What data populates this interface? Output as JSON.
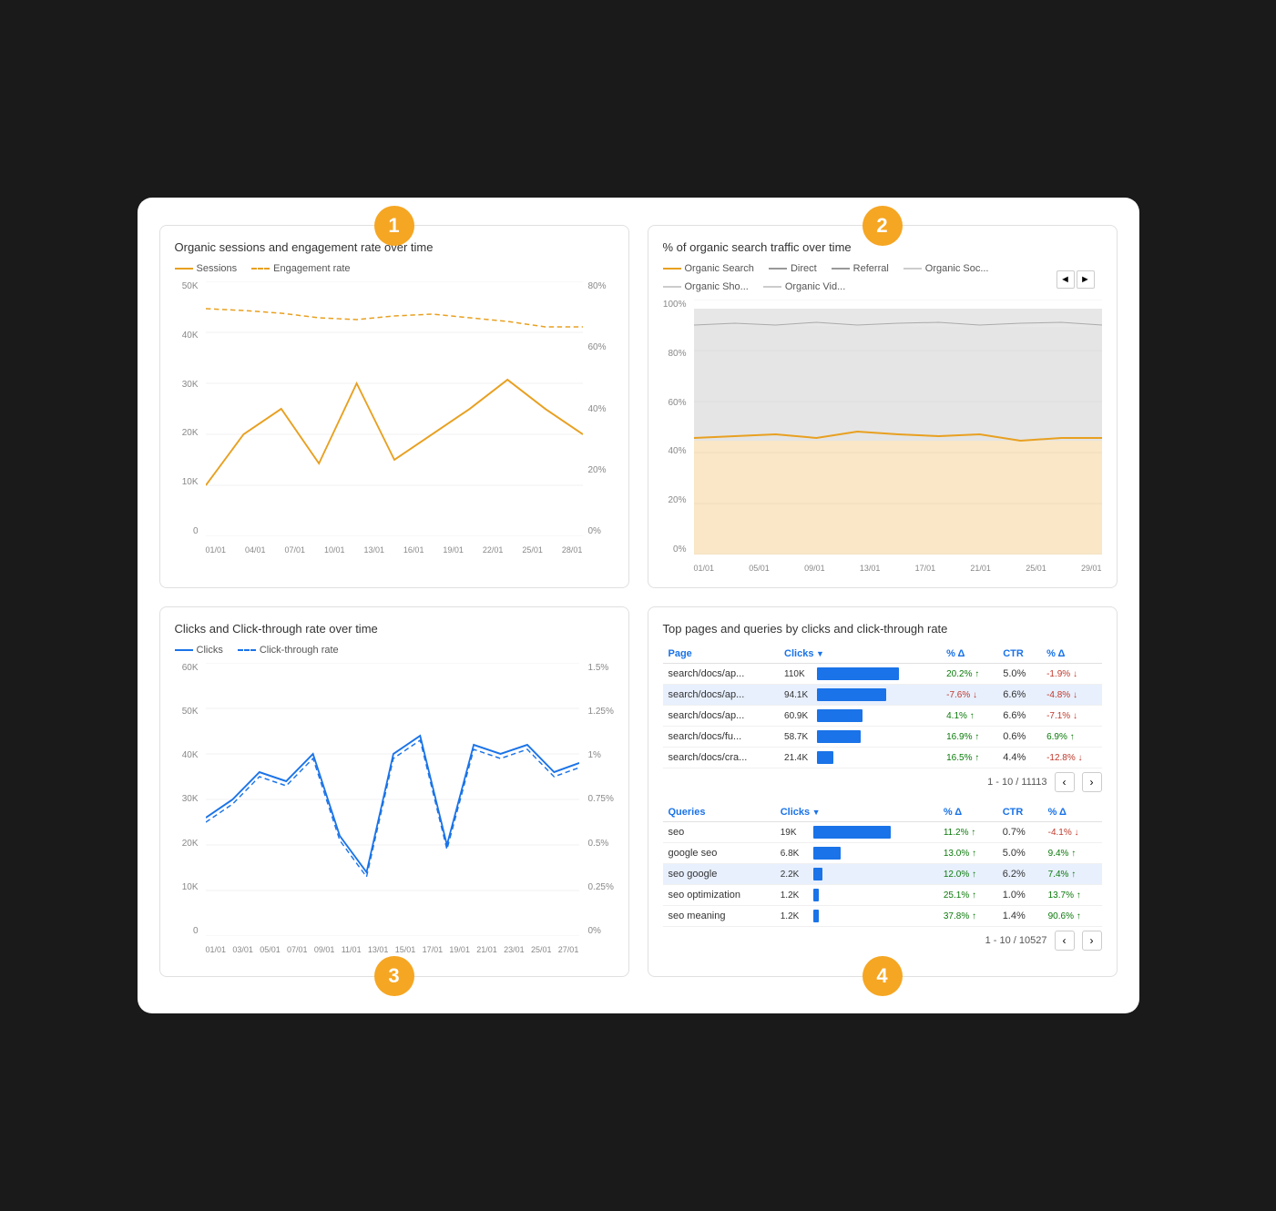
{
  "panel1": {
    "title": "Organic sessions and engagement rate over time",
    "badge": "1",
    "legend": [
      {
        "label": "Sessions",
        "color": "#E8A020",
        "style": "solid"
      },
      {
        "label": "Engagement rate",
        "color": "#E8A020",
        "style": "dashed"
      }
    ],
    "yAxisLeft": [
      "50K",
      "40K",
      "30K",
      "20K",
      "10K",
      "0"
    ],
    "yAxisRight": [
      "80%",
      "60%",
      "40%",
      "20%",
      "0%"
    ],
    "xAxis": [
      "01/01",
      "04/01",
      "07/01",
      "10/01",
      "13/01",
      "16/01",
      "19/01",
      "22/01",
      "25/01",
      "28/01"
    ]
  },
  "panel2": {
    "title": "% of organic search traffic over time",
    "badge": "2",
    "legend": [
      {
        "label": "Organic Search",
        "color": "#E8A020",
        "style": "solid"
      },
      {
        "label": "Direct",
        "color": "#999",
        "style": "solid"
      },
      {
        "label": "Referral",
        "color": "#999",
        "style": "solid"
      },
      {
        "label": "Organic Soc...",
        "color": "#ccc",
        "style": "solid"
      },
      {
        "label": "Organic Sho...",
        "color": "#ccc",
        "style": "solid"
      },
      {
        "label": "Organic Vid...",
        "color": "#ccc",
        "style": "solid"
      }
    ],
    "yAxisLeft": [
      "100%",
      "80%",
      "60%",
      "40%",
      "20%",
      "0%"
    ],
    "xAxis": [
      "01/01",
      "05/01",
      "09/01",
      "13/01",
      "17/01",
      "21/01",
      "25/01",
      "29/01"
    ]
  },
  "panel3": {
    "title": "Clicks and Click-through rate over time",
    "badge": "3",
    "legend": [
      {
        "label": "Clicks",
        "color": "#1a73e8",
        "style": "solid"
      },
      {
        "label": "Click-through rate",
        "color": "#1a73e8",
        "style": "dashed"
      }
    ],
    "yAxisLeft": [
      "60K",
      "50K",
      "40K",
      "30K",
      "20K",
      "10K",
      "0"
    ],
    "yAxisRight": [
      "1.5%",
      "1.25%",
      "1%",
      "0.75%",
      "0.5%",
      "0.25%",
      "0%"
    ],
    "xAxis": [
      "01/01",
      "03/01",
      "05/01",
      "07/01",
      "09/01",
      "11/01",
      "13/01",
      "15/01",
      "17/01",
      "19/01",
      "21/01",
      "23/01",
      "25/01",
      "27/01"
    ]
  },
  "panel4": {
    "title": "Top pages and queries by clicks and click-through rate",
    "badge": "4",
    "pagesTable": {
      "headers": [
        "Page",
        "Clicks",
        "% Δ",
        "CTR",
        "% Δ"
      ],
      "rows": [
        {
          "page": "search/docs/ap...",
          "clicks": "110K",
          "barWidth": 90,
          "deltaPct": "20.2%",
          "deltaDir": "up",
          "ctr": "5.0%",
          "ctrDelta": "-1.9%",
          "ctrDir": "down",
          "highlighted": false
        },
        {
          "page": "search/docs/ap...",
          "clicks": "94.1K",
          "barWidth": 76,
          "deltaPct": "-7.6%",
          "deltaDir": "down",
          "ctr": "6.6%",
          "ctrDelta": "-4.8%",
          "ctrDir": "down",
          "highlighted": true
        },
        {
          "page": "search/docs/ap...",
          "clicks": "60.9K",
          "barWidth": 50,
          "deltaPct": "4.1%",
          "deltaDir": "up",
          "ctr": "6.6%",
          "ctrDelta": "-7.1%",
          "ctrDir": "down",
          "highlighted": false
        },
        {
          "page": "search/docs/fu...",
          "clicks": "58.7K",
          "barWidth": 48,
          "deltaPct": "16.9%",
          "deltaDir": "up",
          "ctr": "0.6%",
          "ctrDelta": "6.9%",
          "ctrDir": "up",
          "highlighted": false
        },
        {
          "page": "search/docs/cra...",
          "clicks": "21.4K",
          "barWidth": 18,
          "deltaPct": "16.5%",
          "deltaDir": "up",
          "ctr": "4.4%",
          "ctrDelta": "-12.8%",
          "ctrDir": "down",
          "highlighted": false
        }
      ],
      "pagination": "1 - 10 / 11113"
    },
    "queriesTable": {
      "headers": [
        "Queries",
        "Clicks",
        "% Δ",
        "CTR",
        "% Δ"
      ],
      "rows": [
        {
          "query": "seo",
          "clicks": "19K",
          "barWidth": 85,
          "deltaPct": "11.2%",
          "deltaDir": "up",
          "ctr": "0.7%",
          "ctrDelta": "-4.1%",
          "ctrDir": "down",
          "highlighted": false
        },
        {
          "query": "google seo",
          "clicks": "6.8K",
          "barWidth": 30,
          "deltaPct": "13.0%",
          "deltaDir": "up",
          "ctr": "5.0%",
          "ctrDelta": "9.4%",
          "ctrDir": "up",
          "highlighted": false
        },
        {
          "query": "seo google",
          "clicks": "2.2K",
          "barWidth": 10,
          "deltaPct": "12.0%",
          "deltaDir": "up",
          "ctr": "6.2%",
          "ctrDelta": "7.4%",
          "ctrDir": "up",
          "highlighted": true
        },
        {
          "query": "seo optimization",
          "clicks": "1.2K",
          "barWidth": 6,
          "deltaPct": "25.1%",
          "deltaDir": "up",
          "ctr": "1.0%",
          "ctrDelta": "13.7%",
          "ctrDir": "up",
          "highlighted": false
        },
        {
          "query": "seo meaning",
          "clicks": "1.2K",
          "barWidth": 6,
          "deltaPct": "37.8%",
          "deltaDir": "up",
          "ctr": "1.4%",
          "ctrDelta": "90.6%",
          "ctrDir": "up",
          "highlighted": false
        }
      ],
      "pagination": "1 - 10 / 10527"
    }
  }
}
